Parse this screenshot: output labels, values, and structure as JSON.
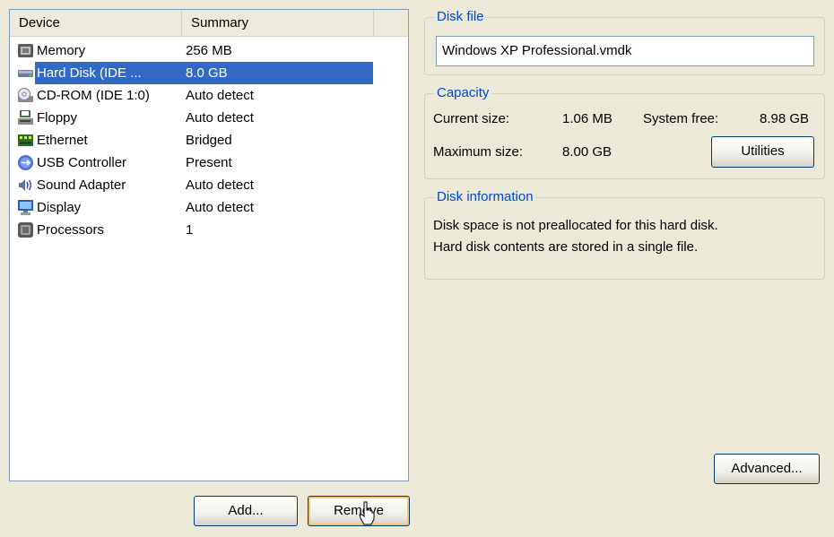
{
  "device_list": {
    "columns": {
      "device": "Device",
      "summary": "Summary"
    },
    "rows": [
      {
        "name": "Memory",
        "summary": "256 MB",
        "icon": "memory-icon",
        "selected": false
      },
      {
        "name": "Hard Disk (IDE ...",
        "summary": "8.0 GB",
        "icon": "hard-disk-icon",
        "selected": true
      },
      {
        "name": "CD-ROM (IDE 1:0)",
        "summary": "Auto detect",
        "icon": "cd-rom-icon",
        "selected": false
      },
      {
        "name": "Floppy",
        "summary": "Auto detect",
        "icon": "floppy-icon",
        "selected": false
      },
      {
        "name": "Ethernet",
        "summary": "Bridged",
        "icon": "ethernet-icon",
        "selected": false
      },
      {
        "name": "USB Controller",
        "summary": "Present",
        "icon": "usb-icon",
        "selected": false
      },
      {
        "name": "Sound Adapter",
        "summary": "Auto detect",
        "icon": "sound-icon",
        "selected": false
      },
      {
        "name": "Display",
        "summary": "Auto detect",
        "icon": "display-icon",
        "selected": false
      },
      {
        "name": "Processors",
        "summary": "1",
        "icon": "processor-icon",
        "selected": false
      }
    ]
  },
  "buttons": {
    "add": "Add...",
    "remove": "Remove",
    "utilities": "Utilities",
    "advanced": "Advanced..."
  },
  "disk_file": {
    "legend": "Disk file",
    "value": "Windows XP Professional.vmdk"
  },
  "capacity": {
    "legend": "Capacity",
    "current_size_label": "Current size:",
    "current_size_value": "1.06 MB",
    "system_free_label": "System free:",
    "system_free_value": "8.98 GB",
    "max_size_label": "Maximum size:",
    "max_size_value": "8.00 GB"
  },
  "disk_info": {
    "legend": "Disk information",
    "line1": "Disk space is not preallocated for this hard disk.",
    "line2": "Hard disk contents are stored in a single file."
  },
  "colors": {
    "window_bg": "#ECE9D8",
    "selection": "#316AC5",
    "group_title": "#0046D5",
    "field_border": "#7F9DB9"
  }
}
